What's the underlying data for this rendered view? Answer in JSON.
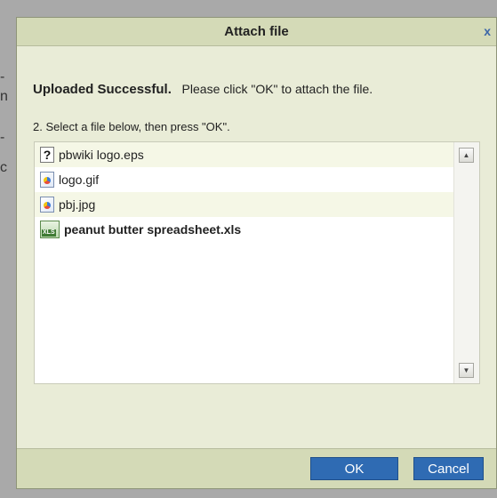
{
  "dialog": {
    "title": "Attach file",
    "close_label": "x"
  },
  "status": {
    "bold_text": "Uploaded Successful.",
    "message": "Please click \"OK\" to attach the file."
  },
  "instruction": "2. Select a file below, then press \"OK\".",
  "files": [
    {
      "name": "pbwiki logo.eps",
      "icon": "unknown-file-icon",
      "bold": false
    },
    {
      "name": "logo.gif",
      "icon": "image-file-icon",
      "bold": false
    },
    {
      "name": "pbj.jpg",
      "icon": "image-file-icon",
      "bold": false
    },
    {
      "name": "peanut butter spreadsheet.xls",
      "icon": "spreadsheet-file-icon",
      "bold": true
    }
  ],
  "scrollbar": {
    "up_icon": "scroll-up-arrow-icon",
    "down_icon": "scroll-down-arrow-icon"
  },
  "buttons": {
    "ok": "OK",
    "cancel": "Cancel"
  },
  "colors": {
    "dialog_bg": "#e9ecd7",
    "titlebar_bg": "#d4dab7",
    "button_blue": "#2f6bb3",
    "close_blue": "#3b66a8"
  }
}
